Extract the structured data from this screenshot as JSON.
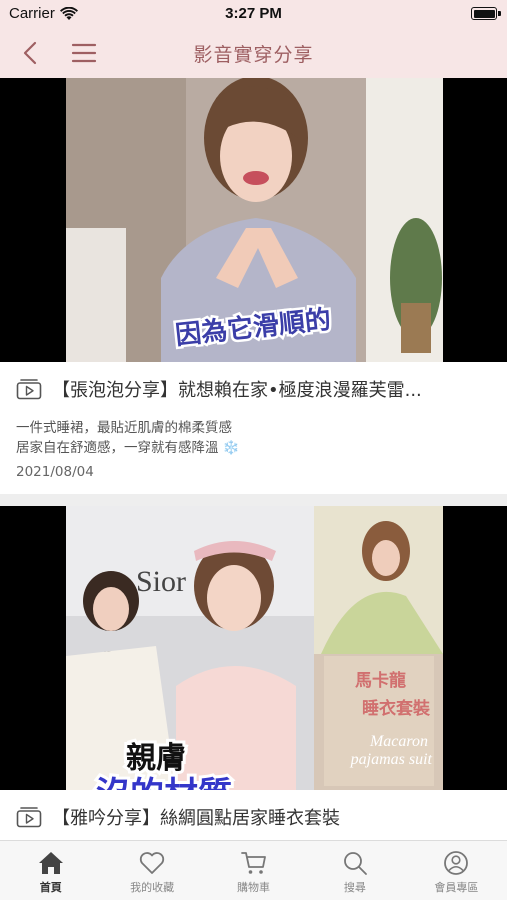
{
  "status_bar": {
    "carrier": "Carrier",
    "time": "3:27 PM",
    "battery_level": 1.0
  },
  "header": {
    "title": "影音實穿分享"
  },
  "feed": {
    "items": [
      {
        "title": "【張泡泡分享】就想賴在家•極度浪漫羅芙雷...",
        "description_line1": "一件式睡裙，最貼近肌膚的棉柔質感",
        "description_line2": "居家自在舒適感，一穿就有感降溫 ❄️",
        "date": "2021/08/04",
        "caption": "因為它滑順的"
      },
      {
        "title": "【雅吟分享】絲綢圓點居家睡衣套裝",
        "caption_main": "親膚",
        "caption_sub": "沒的材質",
        "promo_title_line1": "馬卡龍",
        "promo_title_line2": "睡衣套裝",
        "promo_en_line1": "Macaron",
        "promo_en_line2": "pajamas suit",
        "store_sign": "Sior"
      }
    ]
  },
  "tab_bar": {
    "tabs": [
      {
        "label": "首頁",
        "icon": "home-icon",
        "active": true
      },
      {
        "label": "我的收藏",
        "icon": "heart-icon",
        "active": false
      },
      {
        "label": "購物車",
        "icon": "cart-icon",
        "active": false
      },
      {
        "label": "搜尋",
        "icon": "search-icon",
        "active": false
      },
      {
        "label": "會員專區",
        "icon": "user-icon",
        "active": false
      }
    ]
  },
  "colors": {
    "accent": "#9e5f62",
    "header_bg": "#f7e6e6",
    "tab_bar_bg": "#f7f7f7"
  }
}
